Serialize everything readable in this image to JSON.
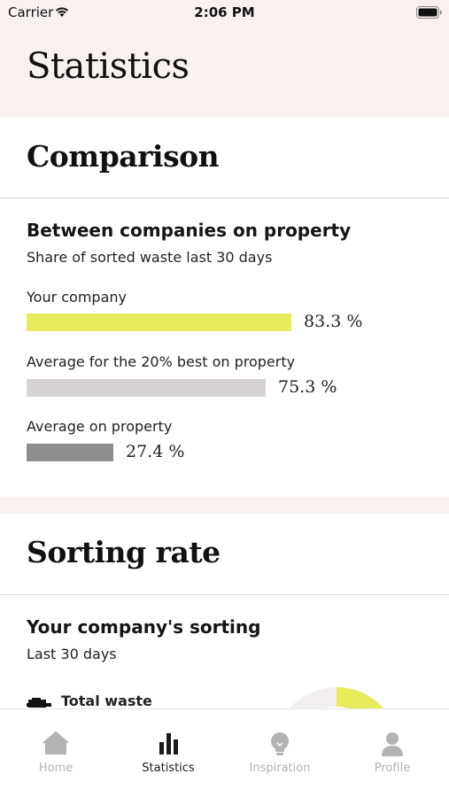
{
  "status_bar": {
    "carrier": "Carrier",
    "time": "2:06 PM"
  },
  "header": {
    "title": "Statistics"
  },
  "comparison": {
    "section_title": "Comparison",
    "card_heading": "Between companies on property",
    "card_subtitle": "Share of sorted waste last 30 days",
    "bars": [
      {
        "label": "Your company",
        "value": 83.3,
        "value_text": "83.3 %",
        "color": "#e6ec5c"
      },
      {
        "label": "Average for the 20% best on property",
        "value": 75.3,
        "value_text": "75.3 %",
        "color": "#d8d3d3"
      },
      {
        "label": "Average on property",
        "value": 27.4,
        "value_text": "27.4 %",
        "color": "#8f8c8c"
      }
    ]
  },
  "sorting_rate": {
    "section_title": "Sorting rate",
    "card_heading": "Your company's sorting",
    "card_subtitle": "Last 30 days",
    "total_label": "Total waste",
    "accent_color": "#e6ec5c"
  },
  "tabs": [
    {
      "label": "Home",
      "icon": "house-icon",
      "active": false
    },
    {
      "label": "Statistics",
      "icon": "bar-chart-icon",
      "active": true
    },
    {
      "label": "Inspiration",
      "icon": "lightbulb-icon",
      "active": false
    },
    {
      "label": "Profile",
      "icon": "person-icon",
      "active": false
    }
  ]
}
